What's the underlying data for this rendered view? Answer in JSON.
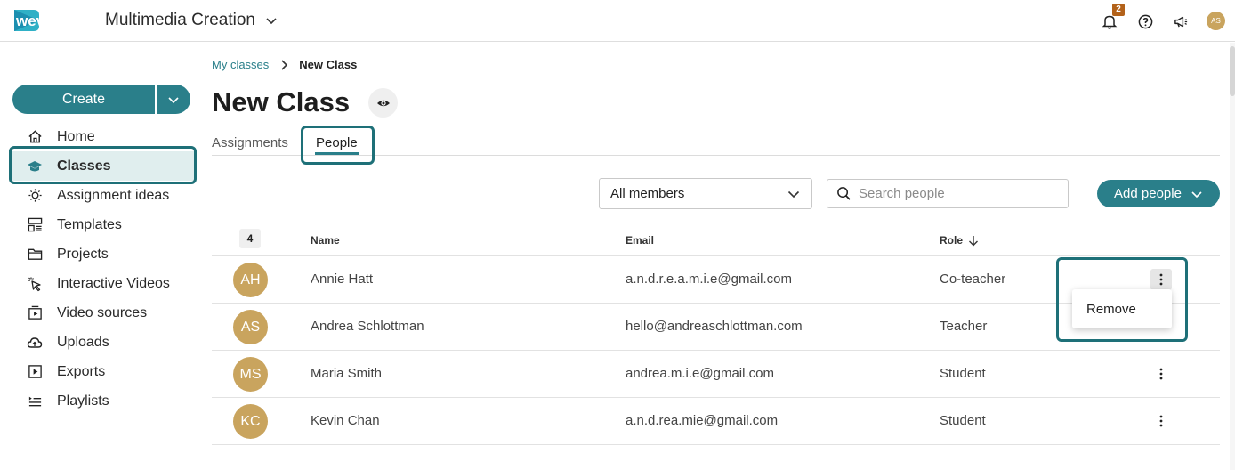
{
  "header": {
    "logo_text": "wevideo",
    "workspace": "Multimedia Creation",
    "notification_count": "2",
    "user_initials": "AS"
  },
  "sidebar": {
    "create_label": "Create",
    "items": [
      {
        "label": "Home",
        "icon": "home-icon"
      },
      {
        "label": "Classes",
        "icon": "graduation-cap-icon",
        "active": true
      },
      {
        "label": "Assignment ideas",
        "icon": "lightbulb-icon"
      },
      {
        "label": "Templates",
        "icon": "templates-icon"
      },
      {
        "label": "Projects",
        "icon": "folder-icon"
      },
      {
        "label": "Interactive Videos",
        "icon": "cursor-click-icon"
      },
      {
        "label": "Video sources",
        "icon": "video-source-icon"
      },
      {
        "label": "Uploads",
        "icon": "cloud-upload-icon"
      },
      {
        "label": "Exports",
        "icon": "export-icon"
      },
      {
        "label": "Playlists",
        "icon": "playlist-icon"
      }
    ]
  },
  "breadcrumb": {
    "parent": "My classes",
    "current": "New Class"
  },
  "page": {
    "title": "New Class"
  },
  "tabs": [
    {
      "label": "Assignments"
    },
    {
      "label": "People",
      "active": true
    }
  ],
  "toolbar": {
    "filter_value": "All members",
    "search_placeholder": "Search people",
    "add_people_label": "Add people"
  },
  "table": {
    "count": "4",
    "columns": {
      "name": "Name",
      "email": "Email",
      "role": "Role"
    },
    "rows": [
      {
        "initials": "AH",
        "name": "Annie Hatt",
        "email": "a.n.d.r.e.a.m.i.e@gmail.com",
        "role": "Co-teacher"
      },
      {
        "initials": "AS",
        "name": "Andrea Schlottman",
        "email": "hello@andreaschlottman.com",
        "role": "Teacher"
      },
      {
        "initials": "MS",
        "name": "Maria Smith",
        "email": "andrea.m.i.e@gmail.com",
        "role": "Student"
      },
      {
        "initials": "KC",
        "name": "Kevin Chan",
        "email": "a.n.d.rea.mie@gmail.com",
        "role": "Student"
      }
    ]
  },
  "row_menu": {
    "remove_label": "Remove"
  },
  "colors": {
    "accent": "#2a7f8a",
    "highlight_border": "#1e7078",
    "avatar": "#c9a45e",
    "badge": "#b3621a"
  }
}
